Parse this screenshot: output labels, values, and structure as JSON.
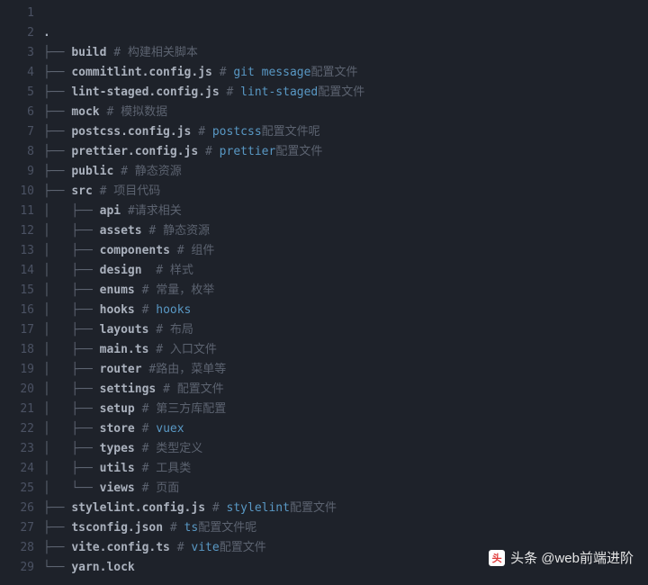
{
  "lines": [
    {
      "n": 1,
      "prefix": "",
      "name": "",
      "comment": null
    },
    {
      "n": 2,
      "prefix": "",
      "name": ".",
      "comment": null
    },
    {
      "n": 3,
      "prefix": "├── ",
      "name": "build",
      "comment": {
        "plain": " 构建相关脚本"
      }
    },
    {
      "n": 4,
      "prefix": "├── ",
      "name": "commitlint.config.js",
      "comment": {
        "kw": " git message",
        "plain": "配置文件"
      }
    },
    {
      "n": 5,
      "prefix": "├── ",
      "name": "lint-staged.config.js",
      "comment": {
        "kw": " lint-staged",
        "plain": "配置文件"
      }
    },
    {
      "n": 6,
      "prefix": "├── ",
      "name": "mock",
      "comment": {
        "plain": " 模拟数据"
      }
    },
    {
      "n": 7,
      "prefix": "├── ",
      "name": "postcss.config.js",
      "comment": {
        "kw": " postcss",
        "plain": "配置文件呢"
      }
    },
    {
      "n": 8,
      "prefix": "├── ",
      "name": "prettier.config.js",
      "comment": {
        "kw": " prettier",
        "plain": "配置文件"
      }
    },
    {
      "n": 9,
      "prefix": "├── ",
      "name": "public",
      "comment": {
        "plain": " 静态资源"
      }
    },
    {
      "n": 10,
      "prefix": "├── ",
      "name": "src",
      "comment": {
        "plain": " 项目代码"
      }
    },
    {
      "n": 11,
      "prefix": "│   ├── ",
      "name": "api",
      "comment": {
        "plain": "请求相关",
        "nospace": true
      }
    },
    {
      "n": 12,
      "prefix": "│   ├── ",
      "name": "assets",
      "comment": {
        "plain": " 静态资源"
      }
    },
    {
      "n": 13,
      "prefix": "│   ├── ",
      "name": "components",
      "comment": {
        "plain": " 组件"
      }
    },
    {
      "n": 14,
      "prefix": "│   ├── ",
      "name": "design ",
      "comment": {
        "plain": " 样式"
      }
    },
    {
      "n": 15,
      "prefix": "│   ├── ",
      "name": "enums",
      "comment": {
        "plain": " 常量，枚举"
      }
    },
    {
      "n": 16,
      "prefix": "│   ├── ",
      "name": "hooks",
      "comment": {
        "kw": " hooks"
      }
    },
    {
      "n": 17,
      "prefix": "│   ├── ",
      "name": "layouts",
      "comment": {
        "plain": " 布局"
      }
    },
    {
      "n": 18,
      "prefix": "│   ├── ",
      "name": "main.ts",
      "comment": {
        "plain": " 入口文件"
      }
    },
    {
      "n": 19,
      "prefix": "│   ├── ",
      "name": "router",
      "comment": {
        "plain": "路由，菜单等",
        "nospace": true
      }
    },
    {
      "n": 20,
      "prefix": "│   ├── ",
      "name": "settings",
      "comment": {
        "plain": " 配置文件"
      }
    },
    {
      "n": 21,
      "prefix": "│   ├── ",
      "name": "setup",
      "comment": {
        "plain": " 第三方库配置"
      }
    },
    {
      "n": 22,
      "prefix": "│   ├── ",
      "name": "store",
      "comment": {
        "kw": " vuex"
      }
    },
    {
      "n": 23,
      "prefix": "│   ├── ",
      "name": "types",
      "comment": {
        "plain": " 类型定义"
      }
    },
    {
      "n": 24,
      "prefix": "│   ├── ",
      "name": "utils",
      "comment": {
        "plain": " 工具类"
      }
    },
    {
      "n": 25,
      "prefix": "│   └── ",
      "name": "views",
      "comment": {
        "plain": " 页面"
      }
    },
    {
      "n": 26,
      "prefix": "├── ",
      "name": "stylelint.config.js",
      "comment": {
        "kw": " stylelint",
        "plain": "配置文件"
      }
    },
    {
      "n": 27,
      "prefix": "├── ",
      "name": "tsconfig.json",
      "comment": {
        "kw": " ts",
        "plain": "配置文件呢"
      }
    },
    {
      "n": 28,
      "prefix": "├── ",
      "name": "vite.config.ts",
      "comment": {
        "kw": " vite",
        "plain": "配置文件"
      }
    },
    {
      "n": 29,
      "prefix": "└── ",
      "name": "yarn.lock",
      "comment": null
    }
  ],
  "watermark": {
    "logo": "头",
    "prefix": "头条 ",
    "handle": "@web前端进阶"
  }
}
